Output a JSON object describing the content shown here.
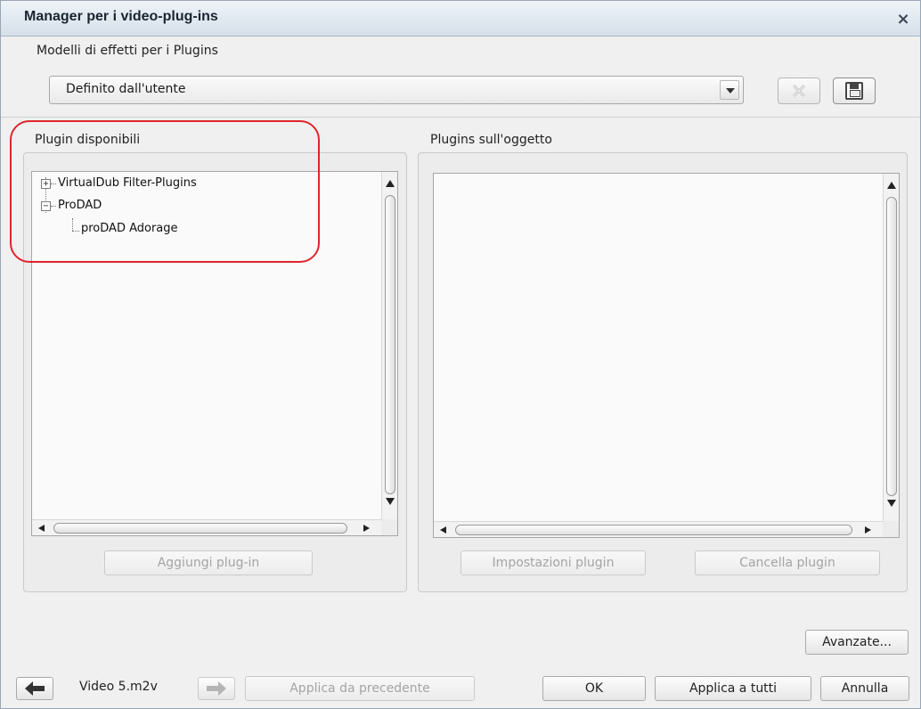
{
  "window": {
    "title": "Manager per i video-plug-ins",
    "close_glyph": "×"
  },
  "presets": {
    "label": "Modelli di effetti per i Plugins",
    "selected": "Definito dall'utente",
    "delete_icon": "delete-preset-icon",
    "save_icon": "save-floppy-icon"
  },
  "available": {
    "label": "Plugin disponibili",
    "tree": [
      {
        "label": "VirtualDub Filter-Plugins",
        "expander": "+",
        "level": 0
      },
      {
        "label": "ProDAD",
        "expander": "−",
        "level": 0
      },
      {
        "label": "proDAD Adorage",
        "expander": "",
        "level": 1
      }
    ],
    "add_button": "Aggiungi plug-in"
  },
  "on_object": {
    "label": "Plugins sull'oggetto",
    "items": [],
    "settings_button": "Impostazioni plugin",
    "delete_button": "Cancella plugin"
  },
  "footer": {
    "advanced_button": "Avanzate...",
    "file_name": "Video 5.m2v",
    "apply_previous_button": "Applica da precedente",
    "ok_button": "OK",
    "apply_all_button": "Applica a tutti",
    "cancel_button": "Annulla"
  },
  "colors": {
    "highlight_ring": "#e0252b",
    "disabled_text": "#a4a4a4"
  }
}
